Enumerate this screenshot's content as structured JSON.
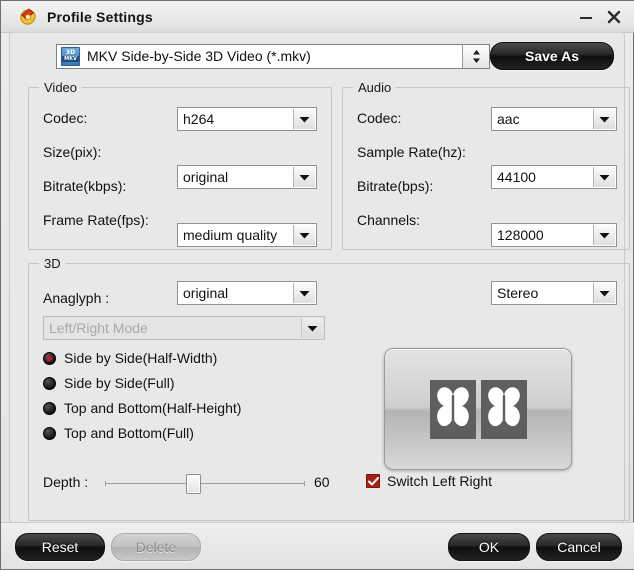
{
  "window": {
    "title": "Profile Settings",
    "title_icon": "profile-settings-icon",
    "minimize_icon": "minimize-icon",
    "close_icon": "close-icon"
  },
  "profile": {
    "file_icon_top": "3D",
    "file_icon_bottom": "MKV",
    "selected": "MKV Side-by-Side 3D Video (*.mkv)",
    "spinner_icon": "spinner-up-down-icon",
    "save_as_label": "Save As"
  },
  "video": {
    "group_title": "Video",
    "fields": [
      {
        "label": "Codec:",
        "value": "h264"
      },
      {
        "label": "Size(pix):",
        "value": "original"
      },
      {
        "label": "Bitrate(kbps):",
        "value": "medium quality"
      },
      {
        "label": "Frame Rate(fps):",
        "value": "original"
      }
    ]
  },
  "audio": {
    "group_title": "Audio",
    "fields": [
      {
        "label": "Codec:",
        "value": "aac"
      },
      {
        "label": "Sample Rate(hz):",
        "value": "44100"
      },
      {
        "label": "Bitrate(bps):",
        "value": "128000"
      },
      {
        "label": "Channels:",
        "value": "Stereo"
      }
    ]
  },
  "three_d": {
    "group_title": "3D",
    "anaglyph_label": "Anaglyph :",
    "anaglyph_value": "Left/Right Mode",
    "anaglyph_enabled": false,
    "modes": [
      {
        "label": "Side by Side(Half-Width)",
        "selected": true
      },
      {
        "label": "Side by Side(Full)",
        "selected": false
      },
      {
        "label": "Top and Bottom(Half-Height)",
        "selected": false
      },
      {
        "label": "Top and Bottom(Full)",
        "selected": false
      }
    ],
    "preview_icon": "side-by-side-butterfly-preview",
    "depth_label": "Depth :",
    "depth_value": "60",
    "depth_percent": 44,
    "switch_label": "Switch Left Right",
    "switch_checked": true,
    "accent_red": "#a52019",
    "radio_dot_red": "#cf1020"
  },
  "footer": {
    "reset_label": "Reset",
    "delete_label": "Delete",
    "delete_enabled": false,
    "ok_label": "OK",
    "cancel_label": "Cancel"
  }
}
